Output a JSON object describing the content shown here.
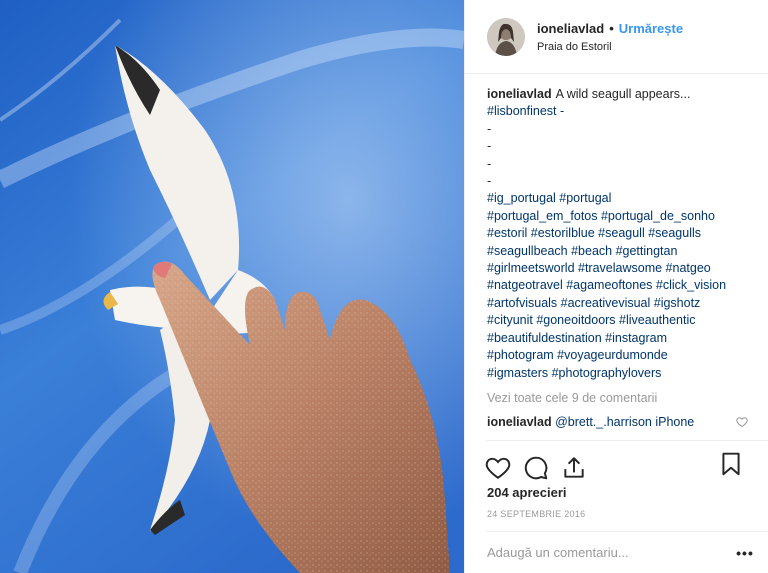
{
  "header": {
    "username": "ioneliavlad",
    "separator": "•",
    "follow_label": "Urmărește",
    "location": "Praia do Estoril"
  },
  "caption": {
    "username": "ioneliavlad",
    "text": "A wild seagull appears...",
    "lines": [
      "#lisbonfinest -",
      "-",
      "-",
      "-",
      "-",
      "#ig_portugal #portugal",
      "#portugal_em_fotos #portugal_de_sonho",
      "#estoril #estorilblue #seagull #seagulls",
      "#seagullbeach #beach #gettingtan",
      "#girlmeetsworld #travelawsome #natgeo",
      "#natgeotravel #agameoftones #click_vision",
      "#artofvisuals #acreativevisual #igshotz",
      "#cityunit #goneoitdoors #liveauthentic",
      "#beautifuldestination #instagram",
      "#photogram #voyageurdumonde",
      "#igmasters #photographylovers"
    ]
  },
  "view_all_comments": "Vezi toate cele 9 de comentarii",
  "comment": {
    "username": "ioneliavlad",
    "text": "@brett._.harrison iPhone"
  },
  "likes": "204 aprecieri",
  "date": "24 SEPTEMBRIE 2016",
  "add_comment_placeholder": "Adaugă un comentariu...",
  "more_label": "•••",
  "icons": {
    "like": "heart-icon",
    "comment": "comment-icon",
    "share": "share-icon",
    "save": "bookmark-icon",
    "comment_like": "small-heart-icon"
  },
  "colors": {
    "link": "#3897f0",
    "hashtag": "#003569",
    "muted": "#999999",
    "sky": "#2f6fd0"
  }
}
